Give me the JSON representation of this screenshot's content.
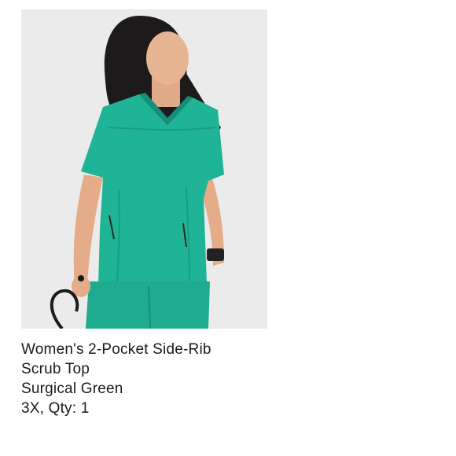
{
  "product": {
    "image_alt": "Woman wearing a green V-neck scrub top holding a stethoscope",
    "title_line1": "Women's 2-Pocket Side-Rib",
    "title_line2": "Scrub Top",
    "color": "Surgical Green",
    "size_qty": "3X, Qty: 1"
  },
  "colors": {
    "scrub": "#20b496",
    "background": "#ebebeb",
    "text": "#1a1a1a"
  }
}
